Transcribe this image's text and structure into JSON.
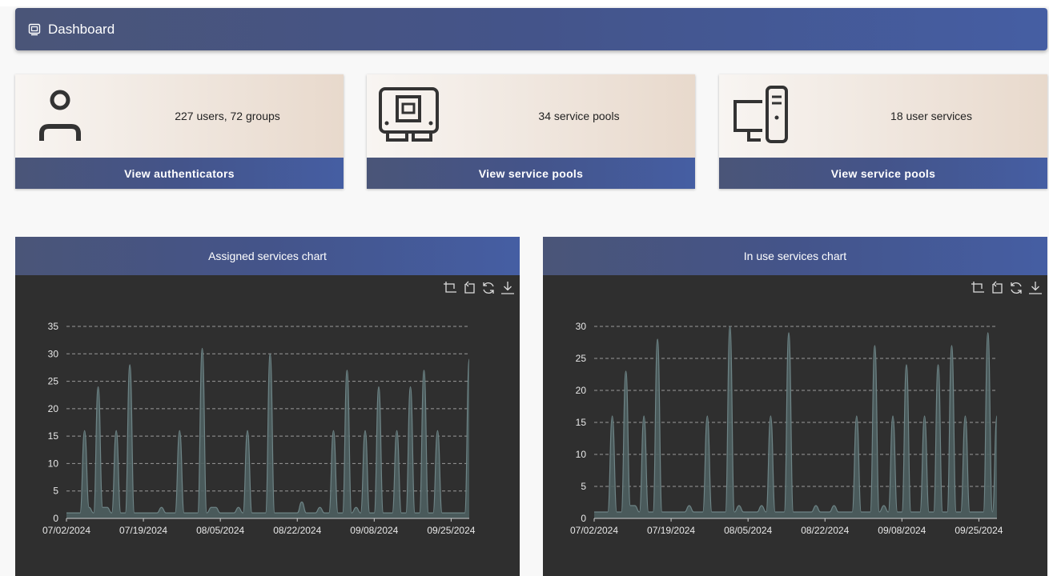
{
  "header": {
    "title": "Dashboard"
  },
  "cards": [
    {
      "text": "227 users, 72 groups",
      "button": "View authenticators",
      "icon": "user-icon"
    },
    {
      "text": "34 service pools",
      "button": "View service pools",
      "icon": "service-pool-icon"
    },
    {
      "text": "18 user services",
      "button": "View service pools",
      "icon": "computer-icon"
    }
  ],
  "colors": {
    "accent": "#455ea3",
    "chart_bg": "#2f2f2f",
    "series_fill": "#4e5f60",
    "series_line": "#6e8486"
  },
  "toolbox_icons": [
    "zoom-icon",
    "zoom-reset-icon",
    "restore-icon",
    "download-icon"
  ],
  "chart_data": [
    {
      "type": "area",
      "title": "Assigned services chart",
      "xlabel": "",
      "ylabel": "",
      "ylim": [
        0,
        35
      ],
      "yticks": [
        0,
        5,
        10,
        15,
        20,
        25,
        30,
        35
      ],
      "xrange": [
        "07/02/2024",
        "09/29/2024"
      ],
      "xtick_labels": [
        "07/02/2024",
        "07/19/2024",
        "08/05/2024",
        "08/22/2024",
        "09/08/2024",
        "09/25/2024"
      ],
      "grid": true,
      "series": [
        {
          "points": [
            [
              "07/02/2024",
              1
            ],
            [
              "07/05/2024",
              1
            ],
            [
              "07/06/2024",
              16
            ],
            [
              "07/07/2024",
              2
            ],
            [
              "07/08/2024",
              1
            ],
            [
              "07/09/2024",
              24
            ],
            [
              "07/10/2024",
              2
            ],
            [
              "07/11/2024",
              2
            ],
            [
              "07/12/2024",
              1
            ],
            [
              "07/13/2024",
              16
            ],
            [
              "07/14/2024",
              1
            ],
            [
              "07/15/2024",
              1
            ],
            [
              "07/16/2024",
              28
            ],
            [
              "07/17/2024",
              1
            ],
            [
              "07/18/2024",
              1
            ],
            [
              "07/22/2024",
              1
            ],
            [
              "07/23/2024",
              2
            ],
            [
              "07/24/2024",
              1
            ],
            [
              "07/26/2024",
              1
            ],
            [
              "07/27/2024",
              16
            ],
            [
              "07/28/2024",
              1
            ],
            [
              "07/31/2024",
              1
            ],
            [
              "08/01/2024",
              31
            ],
            [
              "08/02/2024",
              1
            ],
            [
              "08/03/2024",
              2
            ],
            [
              "08/04/2024",
              2
            ],
            [
              "08/05/2024",
              1
            ],
            [
              "08/08/2024",
              1
            ],
            [
              "08/09/2024",
              2
            ],
            [
              "08/10/2024",
              1
            ],
            [
              "08/11/2024",
              16
            ],
            [
              "08/12/2024",
              1
            ],
            [
              "08/15/2024",
              1
            ],
            [
              "08/16/2024",
              30
            ],
            [
              "08/17/2024",
              1
            ],
            [
              "08/22/2024",
              1
            ],
            [
              "08/23/2024",
              3
            ],
            [
              "08/24/2024",
              1
            ],
            [
              "08/26/2024",
              1
            ],
            [
              "08/27/2024",
              2
            ],
            [
              "08/28/2024",
              1
            ],
            [
              "08/29/2024",
              1
            ],
            [
              "08/30/2024",
              16
            ],
            [
              "08/31/2024",
              1
            ],
            [
              "09/01/2024",
              1
            ],
            [
              "09/02/2024",
              27
            ],
            [
              "09/03/2024",
              1
            ],
            [
              "09/04/2024",
              2
            ],
            [
              "09/05/2024",
              1
            ],
            [
              "09/06/2024",
              16
            ],
            [
              "09/07/2024",
              1
            ],
            [
              "09/08/2024",
              1
            ],
            [
              "09/09/2024",
              24
            ],
            [
              "09/10/2024",
              1
            ],
            [
              "09/12/2024",
              1
            ],
            [
              "09/13/2024",
              16
            ],
            [
              "09/14/2024",
              1
            ],
            [
              "09/15/2024",
              1
            ],
            [
              "09/16/2024",
              24
            ],
            [
              "09/17/2024",
              1
            ],
            [
              "09/18/2024",
              1
            ],
            [
              "09/19/2024",
              27
            ],
            [
              "09/20/2024",
              1
            ],
            [
              "09/21/2024",
              1
            ],
            [
              "09/22/2024",
              16
            ],
            [
              "09/23/2024",
              1
            ],
            [
              "09/28/2024",
              1
            ],
            [
              "09/29/2024",
              29
            ]
          ]
        }
      ]
    },
    {
      "type": "area",
      "title": "In use services chart",
      "xlabel": "",
      "ylabel": "",
      "ylim": [
        0,
        30
      ],
      "yticks": [
        0,
        5,
        10,
        15,
        20,
        25,
        30
      ],
      "xrange": [
        "07/02/2024",
        "09/29/2024"
      ],
      "xtick_labels": [
        "07/02/2024",
        "07/19/2024",
        "08/05/2024",
        "08/22/2024",
        "09/08/2024",
        "09/25/2024"
      ],
      "grid": true,
      "series": [
        {
          "points": [
            [
              "07/02/2024",
              1
            ],
            [
              "07/05/2024",
              1
            ],
            [
              "07/06/2024",
              16
            ],
            [
              "07/07/2024",
              1
            ],
            [
              "07/08/2024",
              1
            ],
            [
              "07/09/2024",
              23
            ],
            [
              "07/10/2024",
              2
            ],
            [
              "07/11/2024",
              2
            ],
            [
              "07/12/2024",
              1
            ],
            [
              "07/13/2024",
              16
            ],
            [
              "07/14/2024",
              1
            ],
            [
              "07/15/2024",
              1
            ],
            [
              "07/16/2024",
              28
            ],
            [
              "07/17/2024",
              1
            ],
            [
              "07/18/2024",
              1
            ],
            [
              "07/22/2024",
              1
            ],
            [
              "07/23/2024",
              2
            ],
            [
              "07/24/2024",
              1
            ],
            [
              "07/26/2024",
              1
            ],
            [
              "07/27/2024",
              16
            ],
            [
              "07/28/2024",
              1
            ],
            [
              "07/31/2024",
              1
            ],
            [
              "08/01/2024",
              30
            ],
            [
              "08/02/2024",
              1
            ],
            [
              "08/03/2024",
              2
            ],
            [
              "08/04/2024",
              1
            ],
            [
              "08/05/2024",
              1
            ],
            [
              "08/07/2024",
              1
            ],
            [
              "08/08/2024",
              2
            ],
            [
              "08/09/2024",
              1
            ],
            [
              "08/10/2024",
              16
            ],
            [
              "08/11/2024",
              1
            ],
            [
              "08/13/2024",
              1
            ],
            [
              "08/14/2024",
              29
            ],
            [
              "08/15/2024",
              1
            ],
            [
              "08/19/2024",
              1
            ],
            [
              "08/20/2024",
              2
            ],
            [
              "08/21/2024",
              1
            ],
            [
              "08/23/2024",
              1
            ],
            [
              "08/24/2024",
              2
            ],
            [
              "08/25/2024",
              1
            ],
            [
              "08/28/2024",
              1
            ],
            [
              "08/29/2024",
              16
            ],
            [
              "08/30/2024",
              1
            ],
            [
              "09/01/2024",
              1
            ],
            [
              "09/02/2024",
              27
            ],
            [
              "09/03/2024",
              1
            ],
            [
              "09/04/2024",
              2
            ],
            [
              "09/05/2024",
              1
            ],
            [
              "09/06/2024",
              16
            ],
            [
              "09/07/2024",
              1
            ],
            [
              "09/08/2024",
              1
            ],
            [
              "09/09/2024",
              24
            ],
            [
              "09/10/2024",
              1
            ],
            [
              "09/12/2024",
              1
            ],
            [
              "09/13/2024",
              16
            ],
            [
              "09/14/2024",
              1
            ],
            [
              "09/15/2024",
              1
            ],
            [
              "09/16/2024",
              24
            ],
            [
              "09/17/2024",
              1
            ],
            [
              "09/18/2024",
              1
            ],
            [
              "09/19/2024",
              27
            ],
            [
              "09/20/2024",
              1
            ],
            [
              "09/21/2024",
              1
            ],
            [
              "09/22/2024",
              16
            ],
            [
              "09/23/2024",
              1
            ],
            [
              "09/26/2024",
              1
            ],
            [
              "09/27/2024",
              29
            ],
            [
              "09/28/2024",
              1
            ],
            [
              "09/29/2024",
              16
            ]
          ]
        }
      ]
    }
  ]
}
